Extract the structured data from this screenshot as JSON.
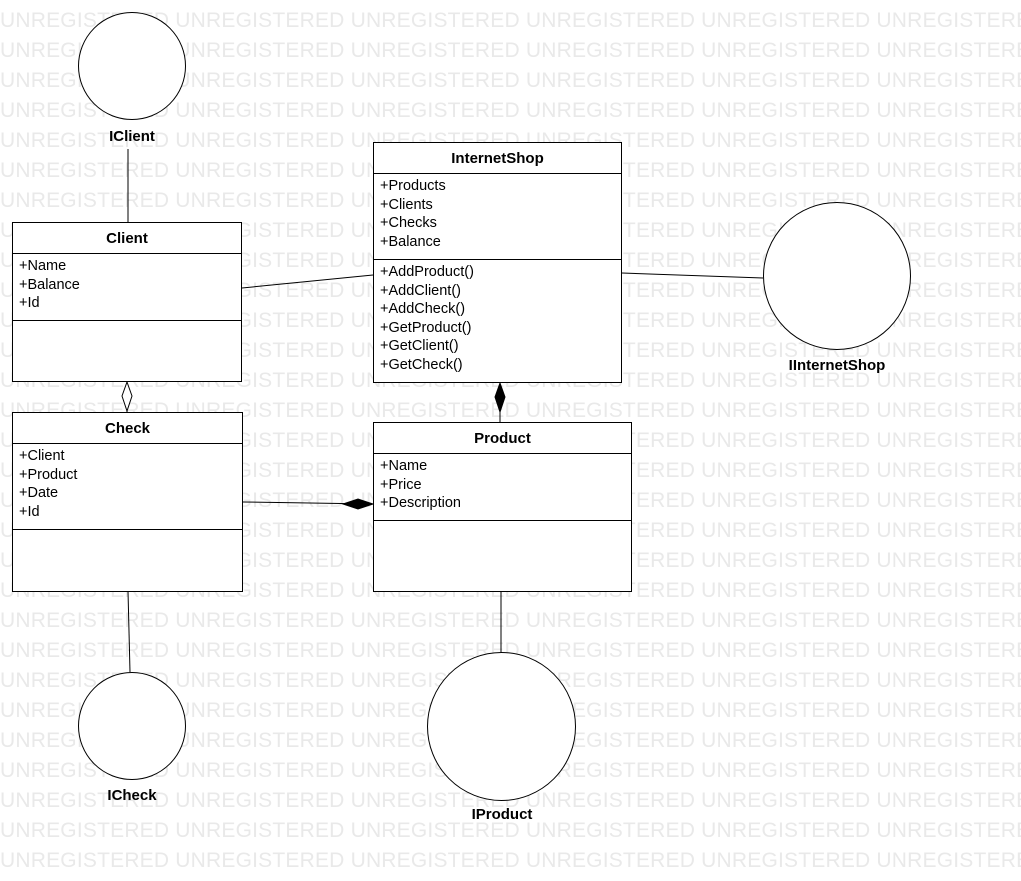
{
  "watermark": {
    "text": "UNREGISTERED UNREGISTERED UNREGISTERED UNREGISTERED UNREGISTERED UNREGISTERED"
  },
  "classes": {
    "internetshop": {
      "name": "InternetShop",
      "attributes": [
        "+Products",
        "+Clients",
        "+Checks",
        "+Balance"
      ],
      "methods": [
        "+AddProduct()",
        "+AddClient()",
        "+AddCheck()",
        "+GetProduct()",
        "+GetClient()",
        "+GetCheck()"
      ]
    },
    "client": {
      "name": "Client",
      "attributes": [
        "+Name",
        "+Balance",
        "+Id"
      ],
      "methods": []
    },
    "check": {
      "name": "Check",
      "attributes": [
        "+Client",
        "+Product",
        "+Date",
        "+Id"
      ],
      "methods": []
    },
    "product": {
      "name": "Product",
      "attributes": [
        "+Name",
        "+Price",
        "+Description"
      ],
      "methods": []
    }
  },
  "interfaces": {
    "iclient": "IClient",
    "iinternetshop": "IInternetShop",
    "icheck": "ICheck",
    "iproduct": "IProduct"
  }
}
